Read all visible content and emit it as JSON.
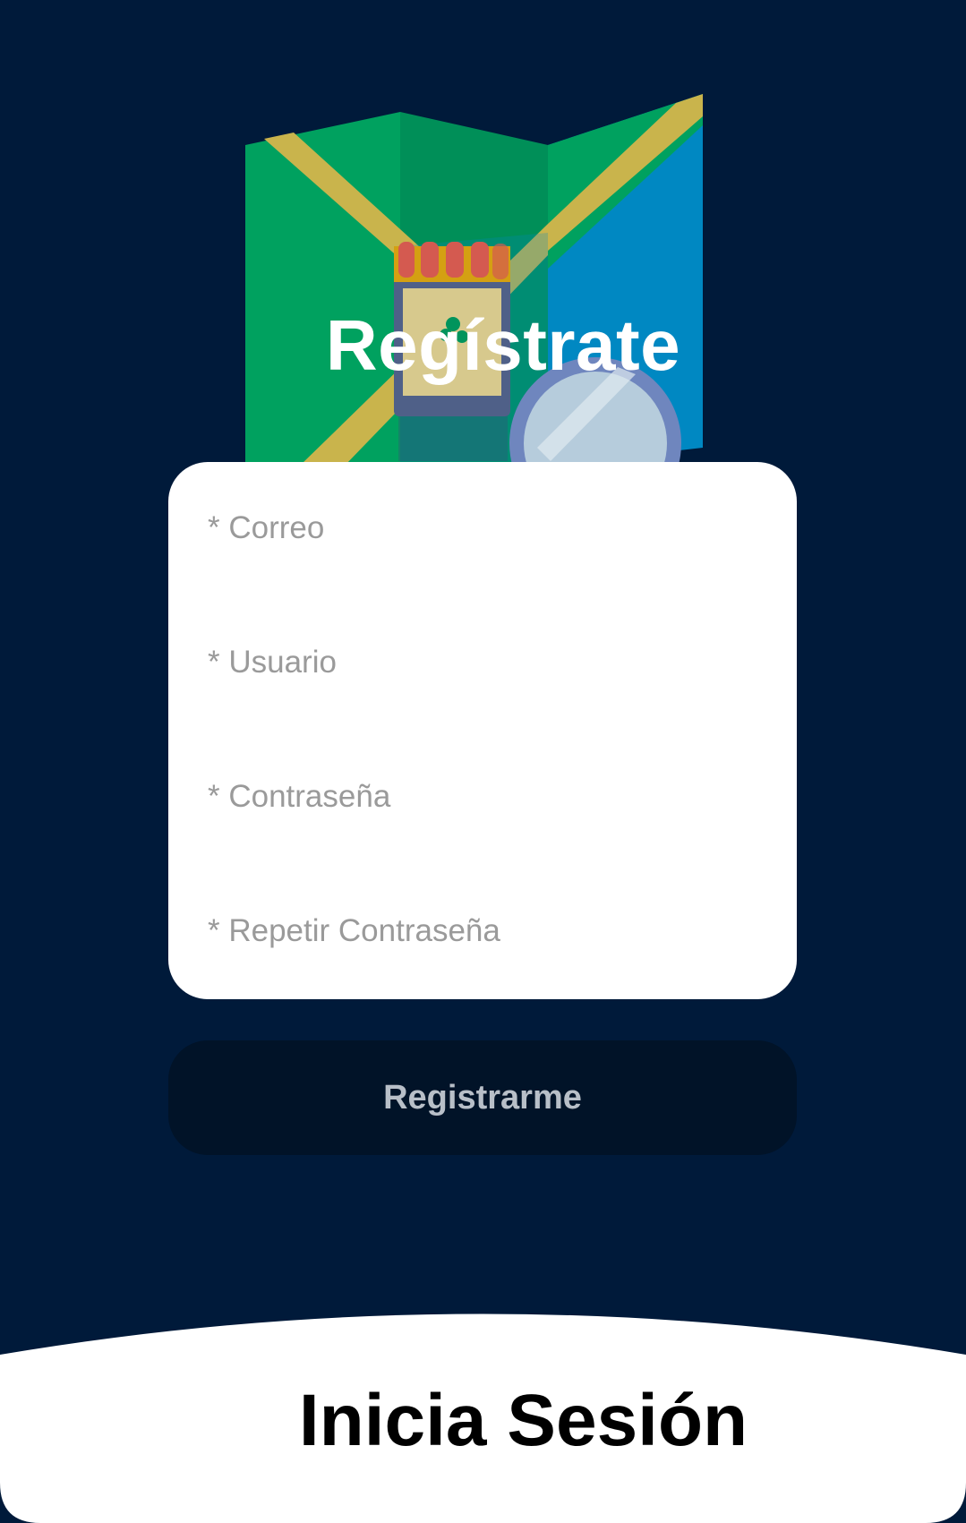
{
  "page": {
    "title": "Regístrate",
    "background_color": "#001a3a"
  },
  "hero": {
    "icon": "map-with-store-illustration"
  },
  "form": {
    "fields": [
      {
        "placeholder": "* Correo",
        "value": ""
      },
      {
        "placeholder": "* Usuario",
        "value": ""
      },
      {
        "placeholder": "* Contraseña",
        "value": ""
      },
      {
        "placeholder": "* Repetir Contraseña",
        "value": ""
      }
    ],
    "submit_label": "Registrarme"
  },
  "footer": {
    "login_label": "Inicia Sesión"
  }
}
